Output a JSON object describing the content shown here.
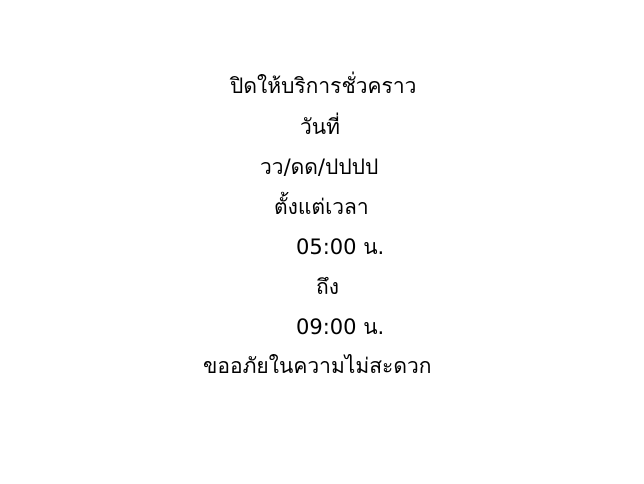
{
  "notice": {
    "title": "ปิดให้บริการชั่วคราว",
    "date_label": "วันที่",
    "date_value": "วว/ดด/ปปปป",
    "from_label": "ตั้งแต่เวลา",
    "start_time": "05:00 น.",
    "to_label": "ถึง",
    "end_time": "09:00 น.",
    "apology": "ขออภัยในความไม่สะดวก"
  },
  "colors": {
    "background": "#ffffff",
    "text": "#000000"
  }
}
